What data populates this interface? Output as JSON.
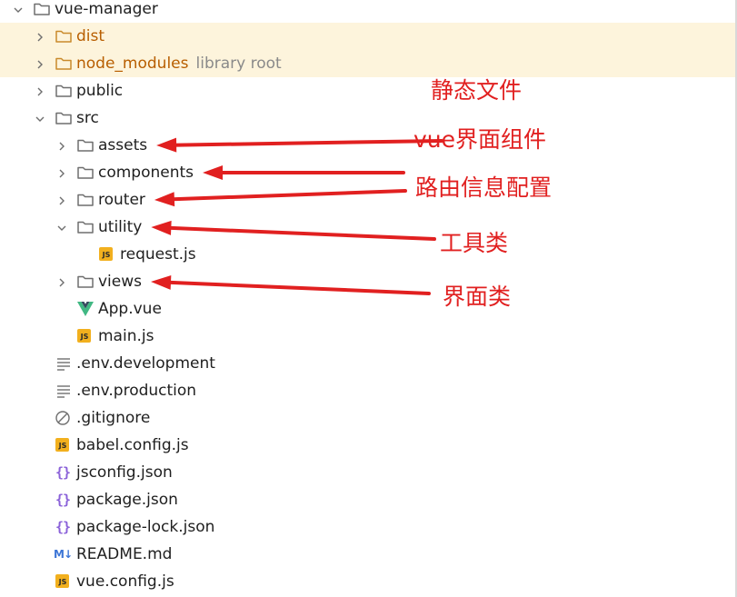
{
  "tree": [
    {
      "label": "vue-manager",
      "icon": "folder",
      "expand": "open",
      "depth": 0
    },
    {
      "label": "dist",
      "icon": "folder-excluded",
      "expand": "closed",
      "depth": 1,
      "excluded": true
    },
    {
      "label": "node_modules",
      "hint": "library root",
      "icon": "folder-excluded",
      "expand": "closed",
      "depth": 1,
      "excluded": true
    },
    {
      "label": "public",
      "icon": "folder",
      "expand": "closed",
      "depth": 1
    },
    {
      "label": "src",
      "icon": "folder",
      "expand": "open",
      "depth": 1
    },
    {
      "label": "assets",
      "icon": "folder",
      "expand": "closed",
      "depth": 2
    },
    {
      "label": "components",
      "icon": "folder",
      "expand": "closed",
      "depth": 2
    },
    {
      "label": "router",
      "icon": "folder",
      "expand": "closed",
      "depth": 2
    },
    {
      "label": "utility",
      "icon": "folder",
      "expand": "open",
      "depth": 2
    },
    {
      "label": "request.js",
      "icon": "js",
      "expand": "none",
      "depth": 3
    },
    {
      "label": "views",
      "icon": "folder",
      "expand": "closed",
      "depth": 2
    },
    {
      "label": "App.vue",
      "icon": "vue",
      "expand": "none",
      "depth": 2
    },
    {
      "label": "main.js",
      "icon": "js",
      "expand": "none",
      "depth": 2
    },
    {
      "label": ".env.development",
      "icon": "text",
      "expand": "none",
      "depth": 1
    },
    {
      "label": ".env.production",
      "icon": "text",
      "expand": "none",
      "depth": 1
    },
    {
      "label": ".gitignore",
      "icon": "ignore",
      "expand": "none",
      "depth": 1
    },
    {
      "label": "babel.config.js",
      "icon": "js",
      "expand": "none",
      "depth": 1
    },
    {
      "label": "jsconfig.json",
      "icon": "json",
      "expand": "none",
      "depth": 1
    },
    {
      "label": "package.json",
      "icon": "json",
      "expand": "none",
      "depth": 1
    },
    {
      "label": "package-lock.json",
      "icon": "json",
      "expand": "none",
      "depth": 1
    },
    {
      "label": "README.md",
      "icon": "md",
      "expand": "none",
      "depth": 1
    },
    {
      "label": "vue.config.js",
      "icon": "js",
      "expand": "none",
      "depth": 1
    }
  ],
  "badges": {
    "js": "JS",
    "md": "M↓",
    "json": "{}"
  },
  "annotations": [
    {
      "text": "静态文件",
      "target": "assets"
    },
    {
      "text": "vue界面组件",
      "target": "components"
    },
    {
      "text": "路由信息配置",
      "target": "router"
    },
    {
      "text": "工具类",
      "target": "utility"
    },
    {
      "text": "界面类",
      "target": "views"
    }
  ],
  "colors": {
    "annotation": "#e12020",
    "excluded_bg": "#fdf4dc",
    "excluded_text": "#b85e00",
    "folder_stroke": "#6e6e6e",
    "js_badge": "#f2b01e",
    "json_braces": "#8b62d9",
    "md_badge": "#3d76d6",
    "vue_green": "#41b883",
    "vue_dark": "#35495e"
  }
}
